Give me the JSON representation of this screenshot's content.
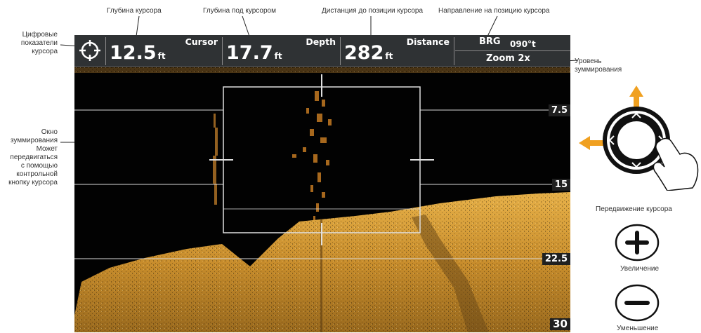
{
  "annotations": {
    "cursor_depth": "Глубина курсора",
    "depth_under_cursor": "Глубина под курсором",
    "distance_to_cursor": "Дистанция до позиции курсора",
    "bearing_to_cursor": "Направление на позицию курсора",
    "digital_readouts": [
      "Цифровые",
      "показатели",
      "курсора"
    ],
    "zoom_level": [
      "Уровень",
      "зуммирования"
    ],
    "zoom_window": [
      "Окно",
      "зуммирования",
      "Может",
      "передвигаться",
      "с помощью",
      "контрольной",
      "кнопку курсора"
    ],
    "cursor_move": "Передвижение курсора",
    "zoom_in": "Увеличение",
    "zoom_out": "Уменьшение"
  },
  "readouts": {
    "cursor": {
      "label": "Cursor",
      "value": "12.5",
      "unit": "ft"
    },
    "depth": {
      "label": "Depth",
      "value": "17.7",
      "unit": "ft"
    },
    "distance": {
      "label": "Distance",
      "value": "282",
      "unit": "ft"
    },
    "bearing": {
      "label": "BRG",
      "value": "090°t"
    },
    "zoom": "Zoom 2x"
  },
  "depth_scale": [
    "7.5",
    "15",
    "22.5",
    "30"
  ],
  "colors": {
    "sonar": "#d9a23a",
    "accent": "#f0a020",
    "bar": "#2f3234"
  },
  "icons": {
    "cursor_indicator": "crosshair-icon",
    "dpad": "cursor-dpad-icon",
    "zoom_in": "plus-icon",
    "zoom_out": "minus-icon"
  }
}
